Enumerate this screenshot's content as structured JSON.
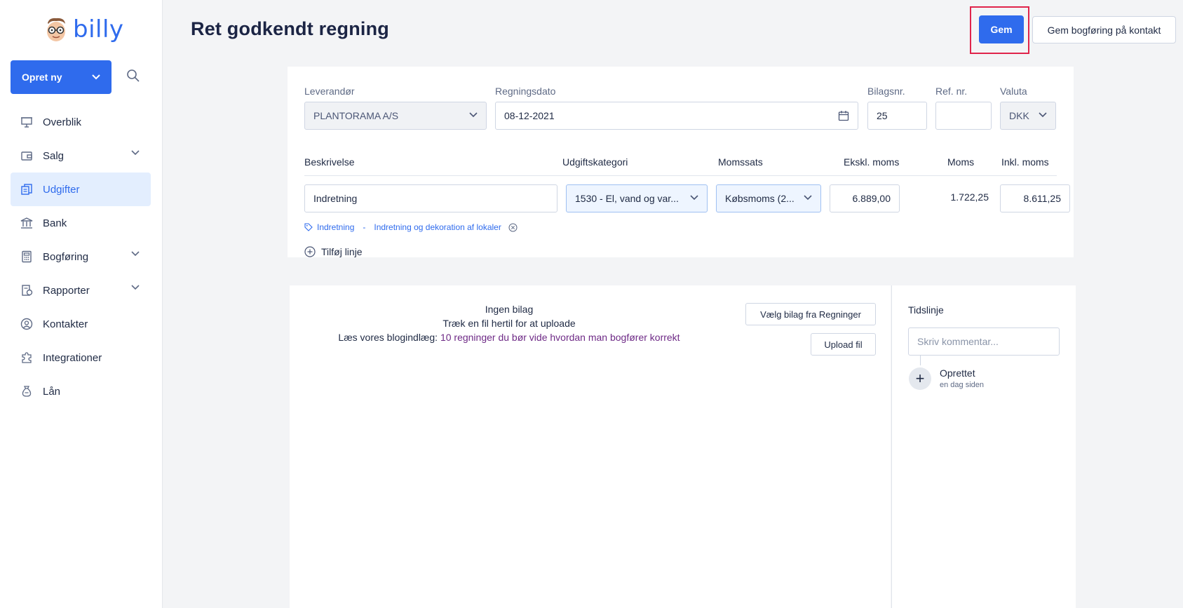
{
  "brand": {
    "name": "billy"
  },
  "sidebar": {
    "create_label": "Opret ny",
    "items": [
      {
        "label": "Overblik",
        "icon": "presentation-icon"
      },
      {
        "label": "Salg",
        "icon": "wallet-icon",
        "expandable": true
      },
      {
        "label": "Udgifter",
        "icon": "receipt-icon",
        "active": true
      },
      {
        "label": "Bank",
        "icon": "bank-icon"
      },
      {
        "label": "Bogføring",
        "icon": "calculator-icon",
        "expandable": true
      },
      {
        "label": "Rapporter",
        "icon": "report-icon",
        "expandable": true
      },
      {
        "label": "Kontakter",
        "icon": "contact-icon"
      },
      {
        "label": "Integrationer",
        "icon": "puzzle-icon"
      },
      {
        "label": "Lån",
        "icon": "moneybag-icon"
      }
    ]
  },
  "header": {
    "title": "Ret godkendt regning",
    "save_label": "Gem",
    "save_contact_label": "Gem bogføring på kontakt"
  },
  "form": {
    "supplier_label": "Leverandør",
    "supplier_value": "PLANTORAMA A/S",
    "date_label": "Regningsdato",
    "date_value": "08-12-2021",
    "voucher_label": "Bilagsnr.",
    "voucher_value": "25",
    "ref_label": "Ref. nr.",
    "ref_value": "",
    "currency_label": "Valuta",
    "currency_value": "DKK",
    "columns": {
      "description": "Beskrivelse",
      "category": "Udgiftskategori",
      "vat_rate": "Momssats",
      "excl": "Ekskl. moms",
      "vat": "Moms",
      "incl": "Inkl. moms"
    },
    "line": {
      "description": "Indretning",
      "category": "1530 - El, vand og var...",
      "vat_rate": "Købsmoms (2...",
      "excl": "6.889,00",
      "vat": "1.722,25",
      "incl": "8.611,25"
    },
    "tag": {
      "name": "Indretning",
      "separator": "-",
      "description": "Indretning og dekoration af lokaler"
    },
    "add_line_label": "Tilføj linje"
  },
  "attachments": {
    "none_label": "Ingen bilag",
    "drag_label": "Træk en fil hertil for at uploade",
    "blog_prefix": "Læs vores blogindlæg:",
    "blog_link": "10 regninger du bør vide hvordan man bogfører korrekt",
    "choose_label": "Vælg bilag fra Regninger",
    "upload_label": "Upload fil"
  },
  "timeline": {
    "title": "Tidslinje",
    "comment_placeholder": "Skriv kommentar...",
    "event_title": "Oprettet",
    "event_time": "en dag siden"
  },
  "colors": {
    "primary": "#2f6bed",
    "highlight": "#e0244b",
    "active_bg": "#e3eefe"
  }
}
